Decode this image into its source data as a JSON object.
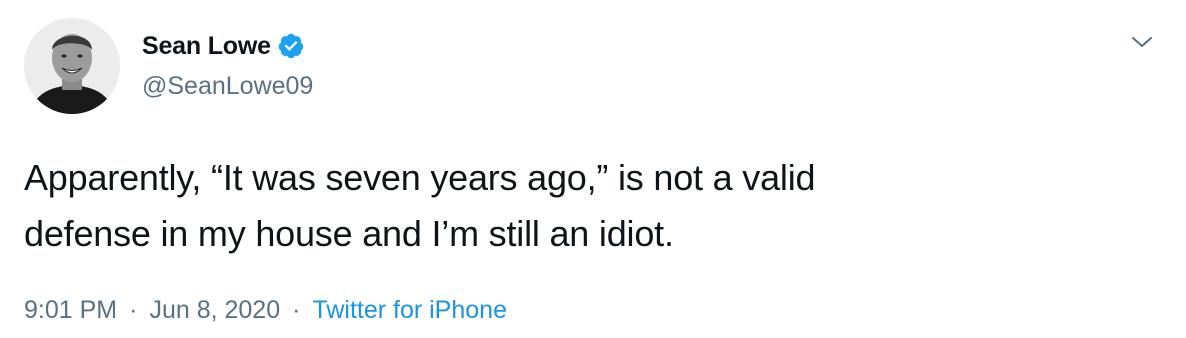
{
  "tweet": {
    "author": {
      "display_name": "Sean Lowe",
      "handle": "@SeanLowe09",
      "verified": true,
      "avatar_icon": "profile-photo"
    },
    "text_lines": [
      "Apparently, “It was seven years ago,” is not a valid",
      "defense in my house and I’m still an idiot."
    ],
    "time": "9:01 PM",
    "separator": "·",
    "date": "Jun 8, 2020",
    "source": "Twitter for iPhone",
    "menu_icon": "chevron-down-icon"
  },
  "colors": {
    "text": "#0f1419",
    "secondary": "#5b7083",
    "link": "#1b95e0",
    "verified": "#1da1f2"
  }
}
